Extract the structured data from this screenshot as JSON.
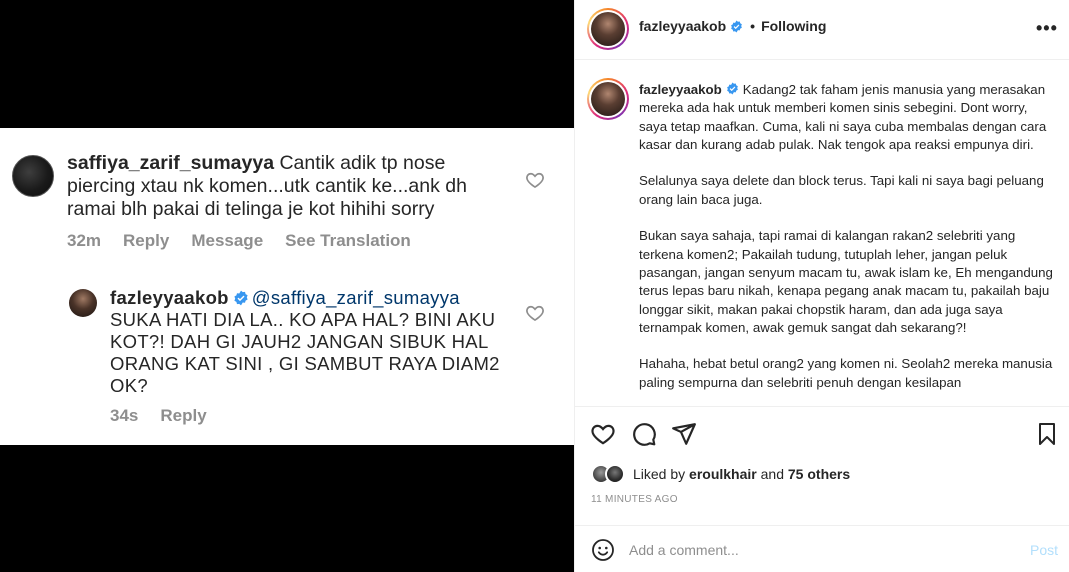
{
  "media": {
    "comment1": {
      "username": "saffiya_zarif_sumayya",
      "text": "Cantik adik tp nose piercing xtau nk komen...utk cantik ke...ank dh ramai blh pakai di telinga je kot hihihi sorry",
      "time": "32m",
      "reply": "Reply",
      "message": "Message",
      "translate": "See Translation"
    },
    "comment2": {
      "username": "fazleyyaakob",
      "mention": "@saffiya_zarif_sumayya",
      "text": "SUKA HATI DIA LA.. KO APA HAL? BINI AKU KOT?! DAH GI JAUH2 JANGAN SIBUK HAL ORANG KAT SINI , GI SAMBUT RAYA DIAM2 OK?",
      "time": "34s",
      "reply": "Reply"
    }
  },
  "header": {
    "username": "fazleyyaakob",
    "separator": "•",
    "following": "Following",
    "more": "•••"
  },
  "caption": {
    "username": "fazleyyaakob",
    "p1": "Kadang2 tak faham jenis manusia yang merasakan mereka ada hak untuk memberi komen sinis sebegini. Dont worry, saya tetap maafkan. Cuma, kali ni saya cuba membalas dengan cara kasar dan kurang adab pulak. Nak tengok apa reaksi empunya diri.",
    "p2": "Selalunya saya delete dan block terus. Tapi kali ni saya bagi peluang orang lain baca juga.",
    "p3": "Bukan saya sahaja, tapi ramai di kalangan rakan2 selebriti yang terkena komen2; Pakailah tudung, tutuplah leher, jangan peluk pasangan, jangan senyum macam tu, awak islam ke, Eh mengandung terus lepas baru nikah, kenapa pegang anak macam tu, pakailah baju longgar sikit, makan pakai chopstik haram, dan ada juga saya ternampak komen, awak gemuk sangat dah sekarang?!",
    "p4": "Hahaha, hebat betul orang2 yang komen ni. Seolah2 mereka manusia paling sempurna dan selebriti penuh dengan kesilapan"
  },
  "likes": {
    "prefix": "Liked by",
    "user": "eroulkhair",
    "and": "and",
    "others": "75 others"
  },
  "timestamp": "11 MINUTES AGO",
  "comment_box": {
    "placeholder": "Add a comment...",
    "post": "Post"
  },
  "colors": {
    "verified": "#3897f0",
    "link": "#00376b",
    "muted": "#8e8e8e",
    "post_disabled": "#b2dffc"
  }
}
